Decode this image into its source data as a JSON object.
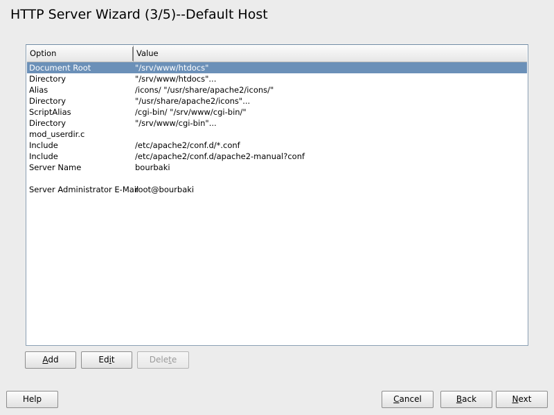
{
  "window": {
    "title": "HTTP Server Wizard (3/5)--Default Host"
  },
  "table": {
    "headers": {
      "option": "Option",
      "value": "Value"
    },
    "rows": [
      {
        "option": "Document Root",
        "value": "\"/srv/www/htdocs\""
      },
      {
        "option": "Directory",
        "value": "\"/srv/www/htdocs\"..."
      },
      {
        "option": "Alias",
        "value": "/icons/ \"/usr/share/apache2/icons/\""
      },
      {
        "option": "Directory",
        "value": "\"/usr/share/apache2/icons\"..."
      },
      {
        "option": "ScriptAlias",
        "value": "/cgi-bin/ \"/srv/www/cgi-bin/\""
      },
      {
        "option": "Directory",
        "value": "\"/srv/www/cgi-bin\"..."
      },
      {
        "option": "mod_userdir.c",
        "value": ""
      },
      {
        "option": "Include",
        "value": "/etc/apache2/conf.d/*.conf"
      },
      {
        "option": "Include",
        "value": "/etc/apache2/conf.d/apache2-manual?conf"
      },
      {
        "option": "Server Name",
        "value": "bourbaki"
      },
      {
        "option": "",
        "value": ""
      },
      {
        "option": "Server Administrator E-Mail",
        "value": "root@bourbaki"
      }
    ]
  },
  "buttons": {
    "add": {
      "pre": "",
      "key": "A",
      "post": "dd"
    },
    "edit": {
      "pre": "Ed",
      "key": "i",
      "post": "t"
    },
    "delete": {
      "pre": "Dele",
      "key": "t",
      "post": "e"
    },
    "help": {
      "label": "Help"
    },
    "cancel": {
      "pre": "",
      "key": "C",
      "post": "ancel"
    },
    "back": {
      "pre": "",
      "key": "B",
      "post": "ack"
    },
    "next": {
      "pre": "",
      "key": "N",
      "post": "ext"
    }
  },
  "colors": {
    "selection": "#6b90b8",
    "background": "#ececec"
  }
}
